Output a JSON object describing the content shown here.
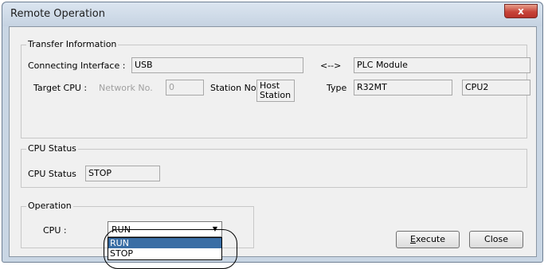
{
  "window": {
    "title": "Remote Operation",
    "close_glyph": "x"
  },
  "transfer": {
    "legend": "Transfer Information",
    "connecting_interface_label": "Connecting Interface :",
    "connecting_interface_value": "USB",
    "arrow": "<-->",
    "target_value": "PLC Module",
    "target_cpu_label": "Target CPU :",
    "network_no_label": "Network No.",
    "network_no_value": "0",
    "station_no_label": "Station No.",
    "station_no_value": "Host\nStation",
    "type_label": "Type",
    "type_value": "R32MT",
    "cpu_value": "CPU2"
  },
  "cpu_status": {
    "legend": "CPU Status",
    "label": "CPU Status",
    "value": "STOP"
  },
  "operation": {
    "legend": "Operation",
    "cpu_label": "CPU :",
    "selected": "RUN",
    "options": [
      "RUN",
      "STOP"
    ],
    "highlighted_option": "RUN"
  },
  "buttons": {
    "execute_underlined": "E",
    "execute_rest": "xecute",
    "close": "Close"
  },
  "colors": {
    "selection_highlight": "#3a6ea5",
    "close_button_red": "#c7443a"
  }
}
